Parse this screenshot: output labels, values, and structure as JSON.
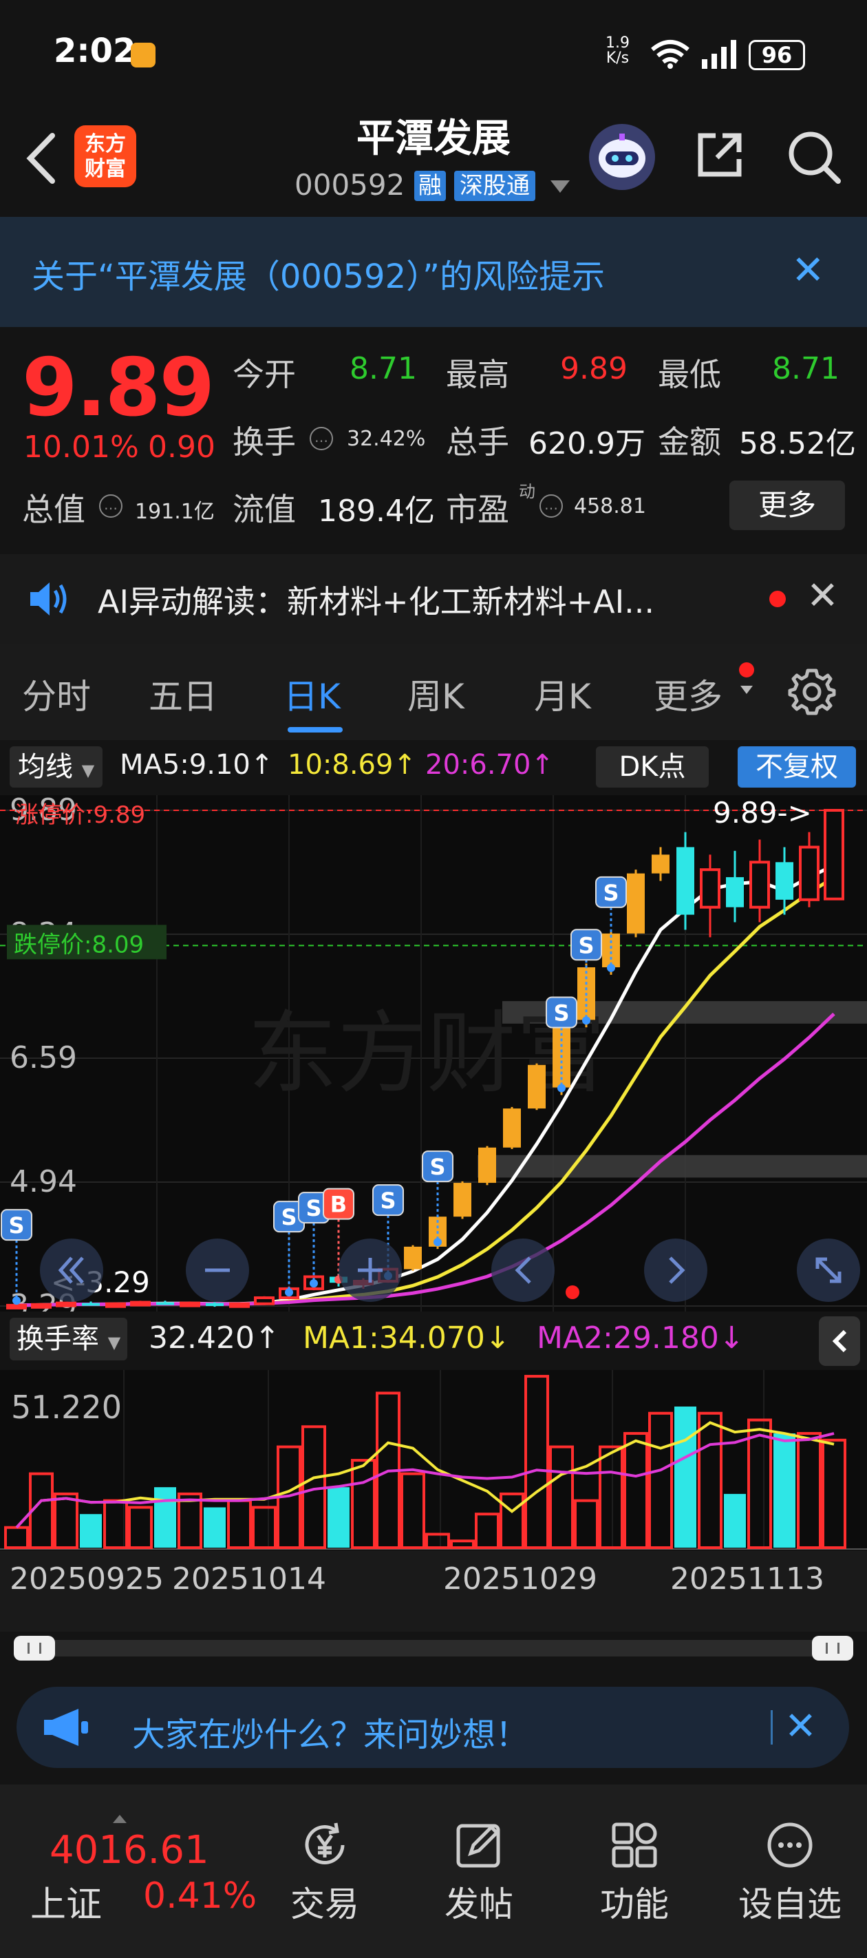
{
  "status_bar": {
    "time": "2:02",
    "speed_value": "1.9",
    "speed_unit": "K/s",
    "battery": "96"
  },
  "header": {
    "logo_line1": "东方",
    "logo_line2": "财富",
    "title": "平潭发展",
    "code": "000592",
    "tag_margin": "融",
    "tag_connect": "深股通"
  },
  "risk_banner": {
    "text": "关于“平潭发展（000592）”的风险提示",
    "close": "✕"
  },
  "quote": {
    "price": "9.89",
    "change_pct": "10.01%",
    "change_amt": "0.90",
    "open_label": "今开",
    "open": "8.71",
    "high_label": "最高",
    "high": "9.89",
    "low_label": "最低",
    "low": "8.71",
    "turnover_label": "换手",
    "turnover": "32.42%",
    "volume_label": "总手",
    "volume": "620.9万",
    "amount_label": "金额",
    "amount": "58.52亿",
    "mktcap_label": "总值",
    "mktcap": "191.1亿",
    "float_label": "流值",
    "float_cap": "189.4亿",
    "pe_label": "市盈",
    "pe_sup": "动",
    "pe": "458.81",
    "info_glyph": "…",
    "more": "更多"
  },
  "ai_bar": {
    "text": "AI异动解读：新材料+化工新材料+AI...",
    "close": "✕"
  },
  "tabs": [
    "分时",
    "五日",
    "日K",
    "周K",
    "月K",
    "更多"
  ],
  "chart_toolbar": {
    "ma_select": "均线",
    "ma5": "MA5:9.10↑",
    "ma10": "10:8.69↑",
    "ma20": "20:6.70↑",
    "dk": "DK点",
    "fuquan": "不复权"
  },
  "kline": {
    "y_ticks": [
      "9.89",
      "8.24",
      "6.59",
      "4.94",
      "3.29"
    ],
    "limit_up_label": "涨停价:9.89",
    "limit_down_label": "跌停价:8.09",
    "last_label": "9.89->",
    "low_label": "<-3.29",
    "signal_s": "S",
    "signal_b": "B",
    "watermark": "东方财富"
  },
  "chart_data": [
    {
      "type": "candlestick",
      "y_range": [
        3.29,
        9.89
      ],
      "ohlc": [
        [
          3.29,
          3.32,
          3.27,
          3.3
        ],
        [
          3.3,
          3.33,
          3.28,
          3.31
        ],
        [
          3.31,
          3.34,
          3.29,
          3.33
        ],
        [
          3.33,
          3.35,
          3.3,
          3.31
        ],
        [
          3.31,
          3.34,
          3.29,
          3.32
        ],
        [
          3.32,
          3.36,
          3.3,
          3.34
        ],
        [
          3.34,
          3.36,
          3.31,
          3.32
        ],
        [
          3.32,
          3.35,
          3.3,
          3.33
        ],
        [
          3.33,
          3.34,
          3.28,
          3.29
        ],
        [
          3.29,
          3.33,
          3.28,
          3.32
        ],
        [
          3.32,
          3.42,
          3.31,
          3.4
        ],
        [
          3.4,
          3.55,
          3.38,
          3.52
        ],
        [
          3.52,
          3.7,
          3.5,
          3.68
        ],
        [
          3.68,
          3.72,
          3.55,
          3.6
        ],
        [
          3.6,
          3.66,
          3.52,
          3.62
        ],
        [
          3.62,
          3.8,
          3.6,
          3.78
        ],
        [
          3.78,
          4.1,
          3.76,
          4.08
        ],
        [
          4.08,
          4.5,
          4.05,
          4.48
        ],
        [
          4.48,
          4.95,
          4.45,
          4.93
        ],
        [
          4.93,
          5.42,
          4.9,
          5.4
        ],
        [
          5.4,
          5.94,
          5.38,
          5.92
        ],
        [
          5.92,
          6.52,
          5.9,
          6.5
        ],
        [
          6.2,
          7.3,
          6.1,
          7.1
        ],
        [
          7.1,
          7.85,
          7.0,
          7.8
        ],
        [
          7.8,
          8.3,
          7.7,
          8.25
        ],
        [
          8.25,
          9.1,
          8.2,
          9.05
        ],
        [
          9.05,
          9.4,
          8.95,
          9.3
        ],
        [
          9.4,
          9.6,
          8.3,
          8.5
        ],
        [
          8.6,
          9.3,
          8.2,
          9.1
        ],
        [
          9.0,
          9.35,
          8.4,
          8.6
        ],
        [
          8.6,
          9.5,
          8.4,
          9.2
        ],
        [
          9.2,
          9.4,
          8.5,
          8.7
        ],
        [
          8.7,
          9.6,
          8.6,
          9.4
        ],
        [
          8.71,
          9.89,
          8.71,
          9.89
        ]
      ]
    },
    {
      "type": "bar",
      "title": "换手率",
      "current": "32.420↑",
      "ma1": "MA1:34.070↓",
      "ma2": "MA2:29.180↓",
      "y_max_label": "51.220",
      "x_labels": [
        "20250925",
        "20251014",
        "20251029",
        "20251113"
      ],
      "values": [
        6,
        22,
        16,
        10,
        14,
        12,
        18,
        16,
        12,
        14,
        12,
        30,
        36,
        18,
        26,
        46,
        22,
        4,
        2,
        10,
        16,
        51,
        30,
        14,
        30,
        34,
        40,
        42,
        40,
        16,
        38,
        34,
        34,
        32
      ]
    }
  ],
  "ask_bar": {
    "text": "大家在炒什么？来问妙想！",
    "close": "✕"
  },
  "bottom_nav": {
    "index_value": "4016.61",
    "index_name": "上证",
    "index_pct": "0.41%",
    "items": [
      "交易",
      "发帖",
      "功能",
      "设自选"
    ]
  }
}
